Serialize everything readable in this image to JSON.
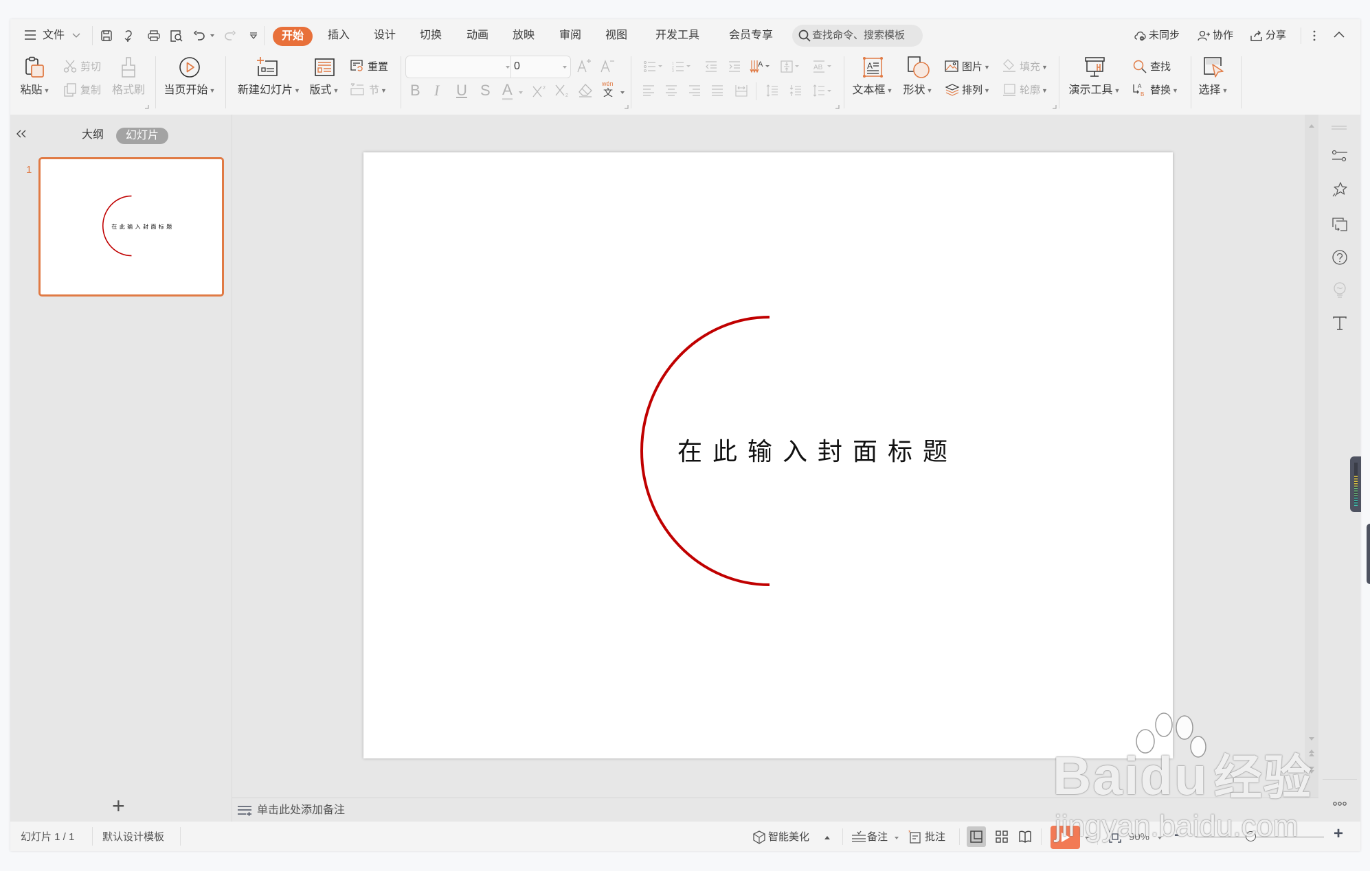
{
  "app": {
    "file_menu_label": "文件",
    "quick_access": [
      "save",
      "export",
      "print",
      "print-preview",
      "undo",
      "redo",
      "customize"
    ]
  },
  "tabs": [
    {
      "label": "开始",
      "active": true
    },
    {
      "label": "插入"
    },
    {
      "label": "设计"
    },
    {
      "label": "切换"
    },
    {
      "label": "动画"
    },
    {
      "label": "放映"
    },
    {
      "label": "审阅"
    },
    {
      "label": "视图"
    },
    {
      "label": "开发工具"
    },
    {
      "label": "会员专享"
    }
  ],
  "search": {
    "placeholder": "查找命令、搜索模板"
  },
  "top_right": {
    "sync": "未同步",
    "collaborate": "协作",
    "share": "分享"
  },
  "ribbon": {
    "paste": "粘贴",
    "cut": "剪切",
    "copy": "复制",
    "format_painter": "格式刷",
    "play_from_current": "当页开始",
    "new_slide": "新建幻灯片",
    "layout": "版式",
    "reset": "重置",
    "section": "节",
    "font_name": "",
    "font_size": "0",
    "bold": "B",
    "italic": "I",
    "underline": "U",
    "strikethrough": "S",
    "font_color": "A",
    "pinyin_top": "wén",
    "pinyin_bottom": "文",
    "textbox": "文本框",
    "shape": "形状",
    "picture": "图片",
    "arrange": "排列",
    "fill": "填充",
    "outline": "轮廓",
    "presentation_tools": "演示工具",
    "find": "查找",
    "replace": "替换",
    "select": "选择"
  },
  "left_panel": {
    "collapse_label": "«",
    "tabs": [
      {
        "label": "大纲"
      },
      {
        "label": "幻灯片",
        "active": true
      }
    ],
    "slides": [
      {
        "number": "1",
        "title": "在此输入封面标题"
      }
    ],
    "add_slide_label": "+"
  },
  "slide": {
    "title": "在此输入封面标题",
    "accent_color": "#c00000"
  },
  "notes": {
    "placeholder": "单击此处添加备注"
  },
  "status": {
    "slide_counter": "幻灯片 1 / 1",
    "template": "默认设计模板",
    "beautify": "智能美化",
    "notes": "备注",
    "comments": "批注",
    "zoom": "90%",
    "zoom_slider_fraction": 0.43,
    "minus": "−",
    "plus": "+"
  },
  "watermark": {
    "brand_left": "Bai",
    "brand_right": "du",
    "suffix": "经验",
    "url": "jingyan.baidu.com"
  },
  "colors": {
    "accent": "#e8703a",
    "icon_orange": "#e07a44",
    "slide_arc": "#c00000",
    "play_button": "#f27a55"
  }
}
